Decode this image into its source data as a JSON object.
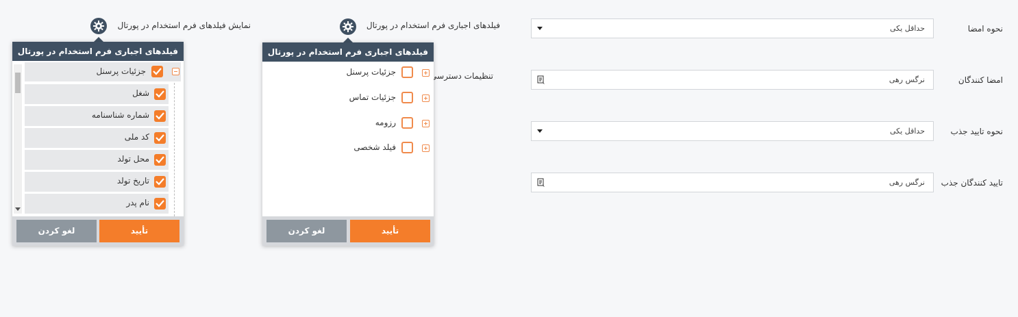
{
  "form": {
    "signature_mode_label": "نحوه امضا",
    "signature_mode_value": "حداقل یکی",
    "signers_label": "امضا کنندگان",
    "signers_value": "نرگس رهی",
    "hire_confirm_mode_label": "نحوه تایید جذب",
    "hire_confirm_mode_value": "حداقل یکی",
    "hire_confirmers_label": "تایید کنندگان جذب",
    "hire_confirmers_value": "نرگس رهی",
    "access_settings_label": "تنظیمات دسترسی"
  },
  "left_header": {
    "label": "نمایش فیلدهای فرم استخدام در پورتال"
  },
  "mid_header": {
    "label": "فیلدهای اجباری فرم استخدام در پورتال"
  },
  "left_panel": {
    "title": "فیلدهای اجباری فرم استخدام در پورتال",
    "parent": {
      "label": "جزئیات پرسنل",
      "checked": true,
      "expanded": true
    },
    "children": [
      {
        "label": "شغل",
        "checked": true
      },
      {
        "label": "شماره شناسنامه",
        "checked": true
      },
      {
        "label": "کد ملی",
        "checked": true
      },
      {
        "label": "محل تولد",
        "checked": true
      },
      {
        "label": "تاریخ تولد",
        "checked": true
      },
      {
        "label": "نام پدر",
        "checked": true
      }
    ],
    "confirm_label": "تأیید",
    "cancel_label": "لغو کردن"
  },
  "mid_panel": {
    "title": "فیلدهای اجباری فرم استخدام در پورتال",
    "items": [
      {
        "label": "جزئیات پرسنل",
        "checked": false
      },
      {
        "label": "جزئیات تماس",
        "checked": false
      },
      {
        "label": "رزومه",
        "checked": false
      },
      {
        "label": "فیلد شخصی",
        "checked": false
      }
    ],
    "confirm_label": "تأیید",
    "cancel_label": "لغو کردن"
  },
  "colors": {
    "accent": "#f47d2a",
    "header_bg": "#3f5062",
    "cancel_bg": "#8e979f"
  },
  "icons": [
    "gear-icon",
    "chevron-down-icon",
    "lookup-icon",
    "checkbox-icon",
    "expand-icon",
    "collapse-icon"
  ]
}
